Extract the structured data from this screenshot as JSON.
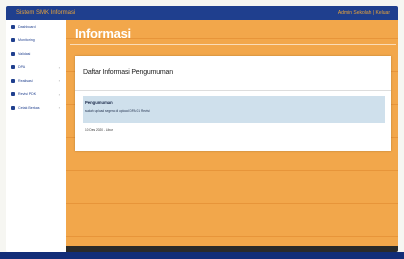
{
  "header": {
    "brand": "Sistem SMK Informasi",
    "user": "Admin Sekolah | Keluar"
  },
  "sidebar": {
    "items": [
      {
        "label": "Dashboard",
        "icon": "dashboard-icon",
        "has_children": false
      },
      {
        "label": "Monitoring",
        "icon": "monitor-icon",
        "has_children": false
      },
      {
        "label": "Validasi",
        "icon": "check-icon",
        "has_children": false
      },
      {
        "label": "DPA",
        "icon": "folder-icon",
        "has_children": true
      },
      {
        "label": "Realisasi",
        "icon": "chart-icon",
        "has_children": true
      },
      {
        "label": "Revisi PDK",
        "icon": "edit-icon",
        "has_children": true
      },
      {
        "label": "Cetak Berkas",
        "icon": "print-icon",
        "has_children": true
      }
    ]
  },
  "main": {
    "title": "Informasi",
    "panel_title": "Daftar Informasi Pengumuman",
    "announcement": {
      "heading": "Pengumuman",
      "body": "sudah upload segera di upload DPA 01 Revisi",
      "date": "10 Des 2020 - Libur"
    }
  },
  "colors": {
    "topbar": "#1f3f8e",
    "accent": "#e8a33a",
    "main_bg": "#f2a74b",
    "announcement_bg": "#cfe0ec"
  }
}
